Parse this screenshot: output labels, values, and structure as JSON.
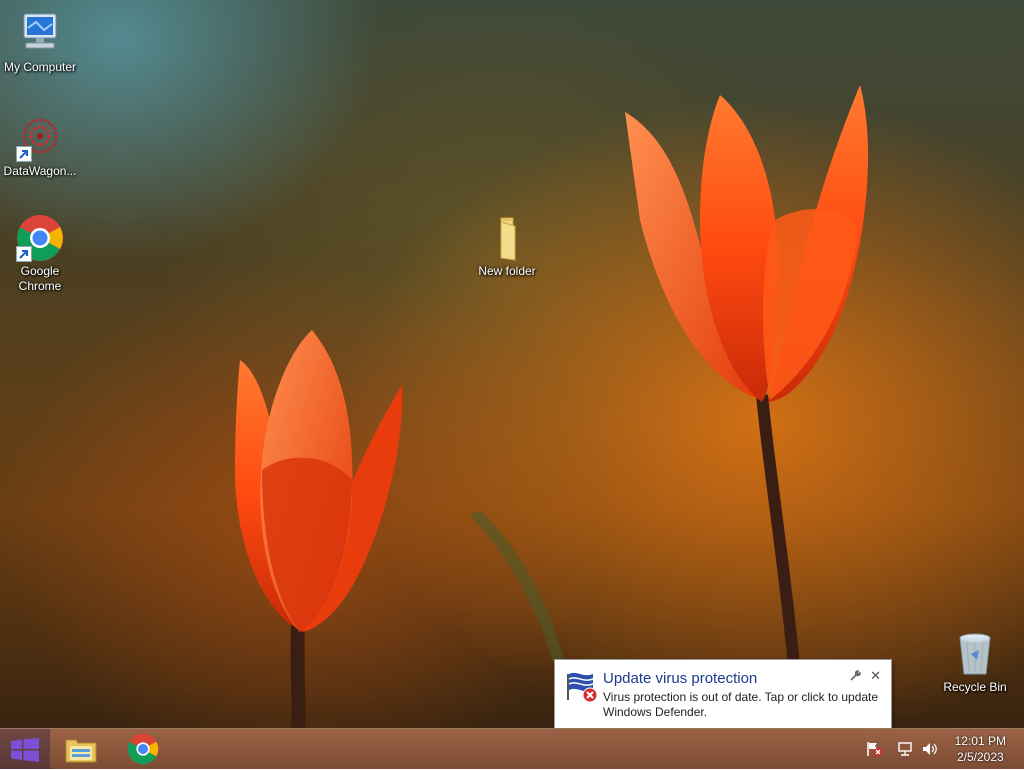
{
  "desktop": {
    "icons": [
      {
        "label": "My Computer",
        "icon": "computer-icon"
      },
      {
        "label": "DataWagon...",
        "icon": "datawagon-icon"
      },
      {
        "label": "Google Chrome",
        "icon": "chrome-icon"
      },
      {
        "label": "New folder",
        "icon": "folder-icon"
      },
      {
        "label": "Recycle Bin",
        "icon": "recycle-bin-icon"
      }
    ]
  },
  "notification": {
    "title": "Update virus protection",
    "body": "Virus protection is out of date. Tap or click to update Windows Defender.",
    "close_glyph": "✕",
    "icon": "defender-flag-error-icon",
    "options_icon": "wrench-icon"
  },
  "taskbar": {
    "start_icon": "windows-logo-icon",
    "pinned": [
      {
        "name": "File Explorer",
        "icon": "file-explorer-icon"
      },
      {
        "name": "Google Chrome",
        "icon": "chrome-icon"
      }
    ],
    "tray_icons": [
      "action-center-flag-icon",
      "network-icon",
      "volume-icon"
    ],
    "time": "12:01 PM",
    "date": "2/5/2023"
  },
  "colors": {
    "accent": "#1c3a8c",
    "start_logo": "#7b4fd6",
    "flower": "#ff4a10"
  }
}
